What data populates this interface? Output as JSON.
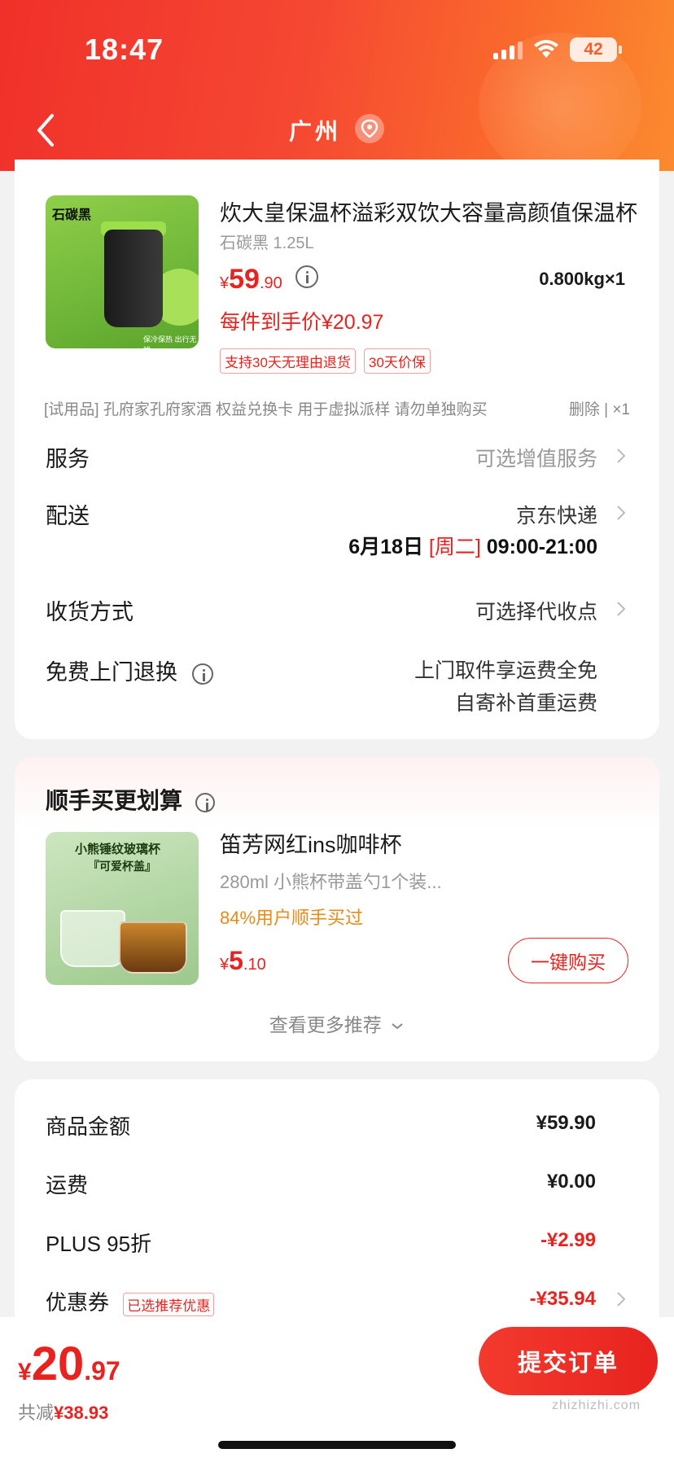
{
  "status_bar": {
    "time": "18:47",
    "battery": "42"
  },
  "nav": {
    "title": "广州"
  },
  "product": {
    "image_tag": "石碳黑",
    "image_caption": "保冷保热 出行无忧",
    "title": "炊大皇保温杯溢彩双饮大容量高颜值保温杯",
    "spec": "石碳黑 1.25L",
    "price_currency": "¥",
    "price_int": "59",
    "price_dec": ".90",
    "weight_qty": "0.800kg×1",
    "unit_price": "每件到手价¥20.97",
    "badges": [
      "支持30天无理由退货",
      "30天价保"
    ]
  },
  "gift": {
    "text": "[试用品] 孔府家孔府家酒 权益兑换卡 用于虚拟派样 请勿单独购买",
    "actions": "删除 | ×1"
  },
  "services": {
    "service_label": "服务",
    "service_value": "可选增值服务",
    "delivery_label": "配送",
    "delivery_value": "京东快递",
    "delivery_date": "6月18日",
    "delivery_weekday": "[周二]",
    "delivery_window": "09:00-21:00",
    "receive_label": "收货方式",
    "receive_value": "可选择代收点",
    "return_label": "免费上门退换",
    "return_line1": "上门取件享运费全免",
    "return_line2": "自寄补首重运费"
  },
  "recommend": {
    "title": "顺手买更划算",
    "image_line1": "小熊锤纹玻璃杯",
    "image_line2": "『可爱杯盖』",
    "item_title": "笛芳网红ins咖啡杯",
    "item_desc": "280ml 小熊杯带盖勺1个装...",
    "item_bought": "84%用户顺手买过",
    "price_currency": "¥",
    "price_int": "5",
    "price_dec": ".10",
    "buy_label": "一键购买",
    "more_label": "查看更多推荐"
  },
  "summary": {
    "goods_label": "商品金额",
    "goods_value": "¥59.90",
    "shipping_label": "运费",
    "shipping_value": "¥0.00",
    "plus_label": "PLUS 95折",
    "plus_value": "-¥2.99",
    "coupon_label": "优惠券",
    "coupon_badge": "已选推荐优惠",
    "coupon_value": "-¥35.94"
  },
  "bottom": {
    "total_currency": "¥",
    "total_int": "20",
    "total_dec": ".97",
    "saving_label": "共减",
    "saving_value": "¥38.93",
    "submit_label": "提交订单",
    "watermark": "zhizhizhi.com"
  },
  "colors": {
    "accent": "#e8231f",
    "header_start": "#f0302a",
    "header_end": "#fb8a2e"
  }
}
